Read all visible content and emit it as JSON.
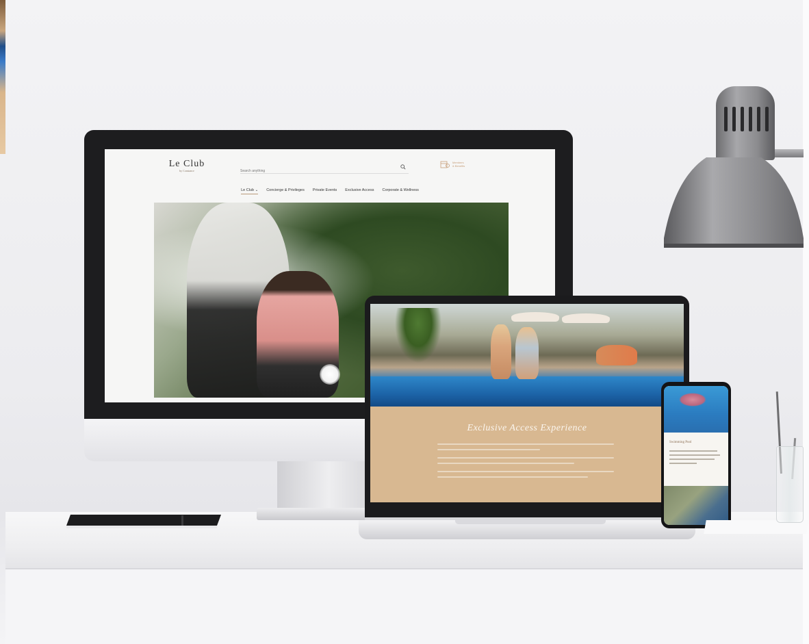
{
  "desktop_site": {
    "logo": {
      "title": "Le Club",
      "subtitle": "by Constance"
    },
    "search": {
      "placeholder": "Search anything"
    },
    "booking": {
      "label_line1": "Members",
      "label_line2": "& Benefits",
      "icon": "booking-icon"
    },
    "nav": [
      {
        "label": "Le Club ⌄",
        "active": true
      },
      {
        "label": "Concierge & Privileges"
      },
      {
        "label": "Private Events"
      },
      {
        "label": "Exclusive Access"
      },
      {
        "label": "Corporate & Wellness"
      }
    ]
  },
  "laptop_site": {
    "section_title": "Exclusive Access Experience"
  },
  "phone_site": {
    "heading": "Swimming Pool"
  },
  "colors": {
    "accent_tan": "#d8b891",
    "gold_text": "#c79f7a",
    "screen_bezel": "#1d1d1f"
  },
  "objects": [
    "desktop-monitor",
    "laptop",
    "smartphone",
    "notebook",
    "desk-lamp",
    "glass-with-straws"
  ]
}
